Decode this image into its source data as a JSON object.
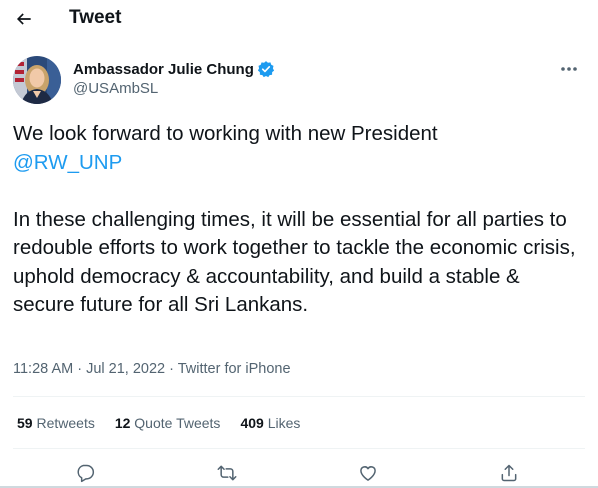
{
  "header": {
    "title": "Tweet"
  },
  "author": {
    "name": "Ambassador Julie Chung",
    "handle": "@USAmbSL"
  },
  "tweet": {
    "line1": "We look forward to working with new President",
    "mention": "@RW_UNP",
    "paragraph2": "In these challenging times, it will be essential for all parties to redouble efforts to work together to tackle the economic crisis, uphold democracy & accountability, and build a stable & secure future for all Sri Lankans."
  },
  "meta": {
    "time": "11:28 AM",
    "sep1": " · ",
    "date": "Jul 21, 2022",
    "sep2": " · ",
    "source": "Twitter for iPhone"
  },
  "stats": {
    "retweets_count": "59",
    "retweets_label": "Retweets",
    "quotes_count": "12",
    "quotes_label": "Quote Tweets",
    "likes_count": "409",
    "likes_label": "Likes"
  },
  "colors": {
    "accent": "#1d9bf0",
    "text": "#0f1419",
    "secondary": "#536471",
    "divider": "#eff3f4"
  },
  "icons": [
    "back-arrow-icon",
    "verified-badge-icon",
    "more-icon",
    "reply-icon",
    "retweet-icon",
    "like-icon",
    "share-icon"
  ]
}
